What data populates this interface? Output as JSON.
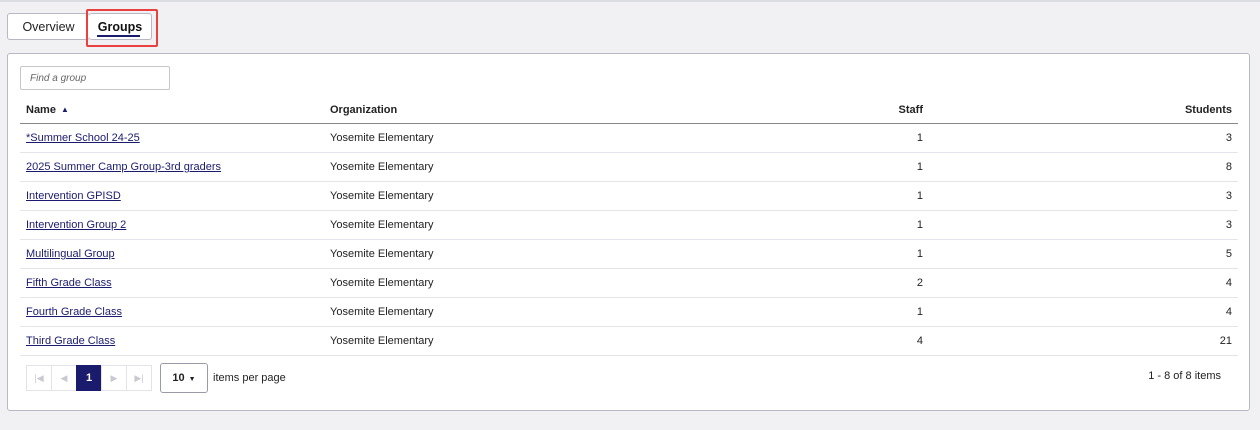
{
  "tabs": [
    {
      "label": "Overview"
    },
    {
      "label": "Groups"
    }
  ],
  "search": {
    "placeholder": "Find a group",
    "value": ""
  },
  "table": {
    "headers": {
      "name": "Name",
      "organization": "Organization",
      "staff": "Staff",
      "students": "Students"
    },
    "rows": [
      {
        "name": "*Summer School 24-25",
        "organization": "Yosemite Elementary",
        "staff": "1",
        "students": "3"
      },
      {
        "name": "2025 Summer Camp Group-3rd graders",
        "organization": "Yosemite Elementary",
        "staff": "1",
        "students": "8"
      },
      {
        "name": "Intervention GPISD",
        "organization": "Yosemite Elementary",
        "staff": "1",
        "students": "3"
      },
      {
        "name": "Intervention Group 2",
        "organization": "Yosemite Elementary",
        "staff": "1",
        "students": "3"
      },
      {
        "name": "Multilingual Group",
        "organization": "Yosemite Elementary",
        "staff": "1",
        "students": "5"
      },
      {
        "name": "Fifth Grade Class",
        "organization": "Yosemite Elementary",
        "staff": "2",
        "students": "4"
      },
      {
        "name": "Fourth Grade Class",
        "organization": "Yosemite Elementary",
        "staff": "1",
        "students": "4"
      },
      {
        "name": "Third Grade Class",
        "organization": "Yosemite Elementary",
        "staff": "4",
        "students": "21"
      }
    ]
  },
  "pager": {
    "current_page": "1",
    "page_size": "10",
    "items_per_page_label": "items per page",
    "info": "1 - 8 of 8 items"
  },
  "colors": {
    "accent": "#1b1b6e",
    "highlight": "#e8413f"
  },
  "icons": {
    "sort": "sort-ascending-icon",
    "first": "first-page-icon",
    "prev": "previous-page-icon",
    "next": "next-page-icon",
    "last": "last-page-icon",
    "dropdown": "chevron-down-icon"
  }
}
